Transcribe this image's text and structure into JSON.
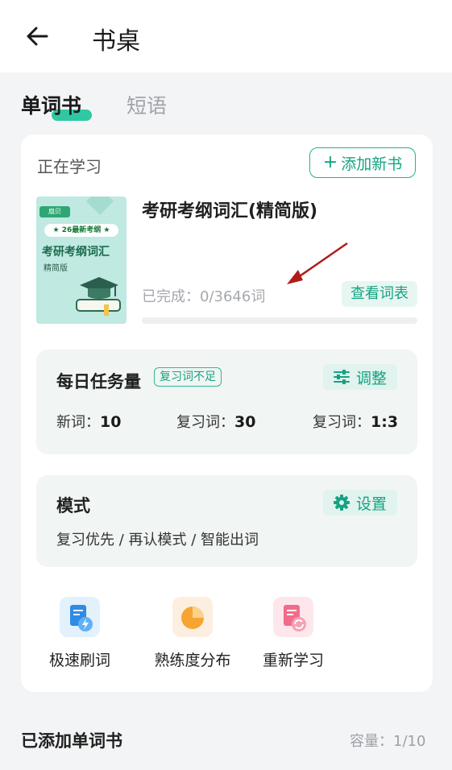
{
  "header": {
    "title": "书桌"
  },
  "tabs": [
    {
      "label": "单词书",
      "active": true
    },
    {
      "label": "短语",
      "active": false
    }
  ],
  "current_book": {
    "section_label": "正在学习",
    "add_button_label": "添加新书",
    "cover": {
      "brand": "扇贝",
      "tag": "★ 26最新考纲 ★",
      "title": "考研考纲词汇",
      "subtitle": "精简版"
    },
    "title": "考研考纲词汇(精简版)",
    "progress_text": "已完成：0/3646词",
    "progress_fraction": 0.0,
    "view_list_label": "查看词表"
  },
  "daily_task": {
    "title": "每日任务量",
    "badge": "复习词不足",
    "adjust_label": "调整",
    "new_words_label": "新词：",
    "new_words_value": "10",
    "review_words_label": "复习词：",
    "review_words_value": "30",
    "ratio_label": "复习词：",
    "ratio_value": "1:3"
  },
  "mode": {
    "title": "模式",
    "settings_label": "设置",
    "description": "复习优先 / 再认模式 / 智能出词"
  },
  "functions": [
    {
      "label": "极速刷词",
      "icon": "lightning-doc-icon"
    },
    {
      "label": "熟练度分布",
      "icon": "pie-chart-icon"
    },
    {
      "label": "重新学习",
      "icon": "refresh-doc-icon"
    }
  ],
  "added_books": {
    "title": "已添加单词书",
    "capacity": "容量：1/10"
  },
  "colors": {
    "accent": "#22b391",
    "accent_light": "#e1f3ee",
    "annotation_arrow": "#b01c1c"
  }
}
